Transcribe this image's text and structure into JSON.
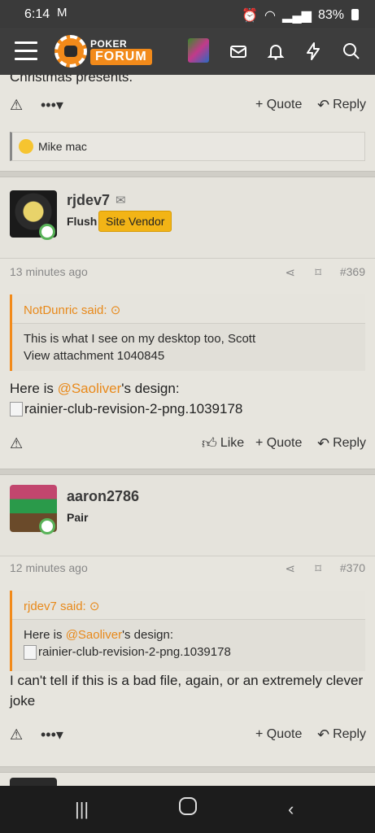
{
  "status": {
    "time": "6:14",
    "battery": "83%"
  },
  "appbar": {
    "logo_top": "POKER CHIP",
    "logo_bottom": "FORUM"
  },
  "post0": {
    "cut_text": "Christmas presents.",
    "quote_label": "+ Quote",
    "reply_label": "Reply",
    "reaction_user": "Mike mac"
  },
  "post1": {
    "username": "rjdev7",
    "rank": "Flush",
    "badge": "Site Vendor",
    "time": "13 minutes ago",
    "number": "#369",
    "quote_author": "NotDunric said:",
    "quote_line1": "This is what I see on my desktop too, Scott",
    "quote_line2": "View attachment 1040845",
    "body_prefix": "Here is ",
    "mention": "@Saoliver",
    "body_suffix": "'s design:",
    "image_alt": "rainier-club-revision-2-png.1039178",
    "like_label": "Like",
    "quote_label": "+ Quote",
    "reply_label": "Reply"
  },
  "post2": {
    "username": "aaron2786",
    "rank": "Pair",
    "time": "12 minutes ago",
    "number": "#370",
    "quote_author": "rjdev7 said:",
    "quote_prefix": "Here is ",
    "quote_mention": "@Saoliver",
    "quote_suffix": "'s design:",
    "quote_image_alt": "rainier-club-revision-2-png.1039178",
    "body": "I can't tell if this is a bad file, again, or an extremely clever joke",
    "quote_label": "+ Quote",
    "reply_label": "Reply"
  }
}
